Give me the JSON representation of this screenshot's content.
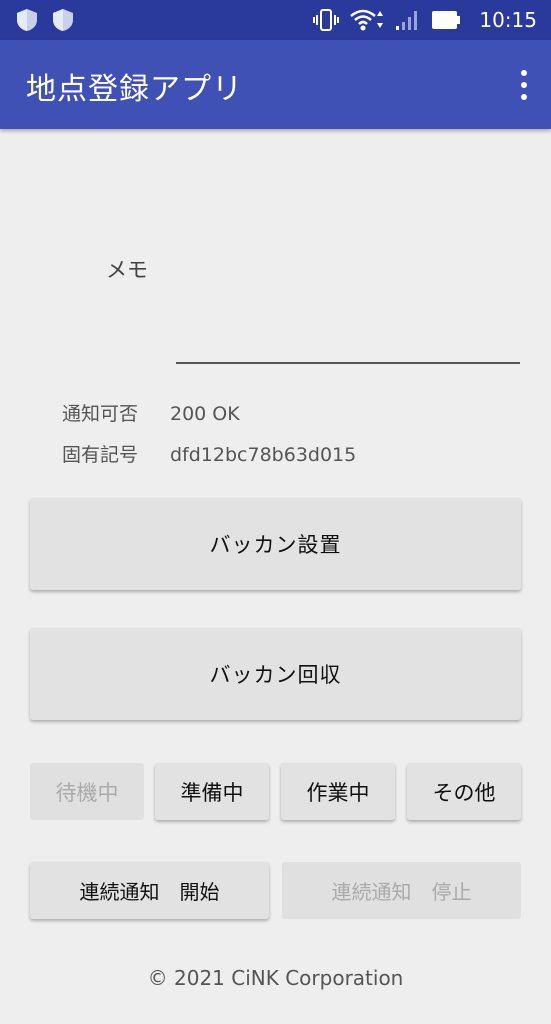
{
  "status_bar": {
    "time": "10:15",
    "icons": [
      "shield-icon",
      "shield-icon",
      "vibrate-icon",
      "wifi-icon",
      "signal-icon",
      "battery-icon"
    ]
  },
  "app_bar": {
    "title": "地点登録アプリ",
    "menu_icon": "more-vert-icon"
  },
  "form": {
    "memo_label": "メモ",
    "memo_value": "",
    "notify_label": "通知可否",
    "notify_value": "200 OK",
    "id_label": "固有記号",
    "id_value": "dfd12bc78b63d015"
  },
  "buttons": {
    "install": "バッカン設置",
    "collect": "バッカン回収",
    "status": [
      {
        "label": "待機中",
        "enabled": false
      },
      {
        "label": "準備中",
        "enabled": true
      },
      {
        "label": "作業中",
        "enabled": true
      },
      {
        "label": "その他",
        "enabled": true
      }
    ],
    "continuous_start": "連続通知　開始",
    "continuous_stop": "連続通知　停止"
  },
  "footer": "© 2021 CiNK Corporation",
  "colors": {
    "status_bar": "#2a3a9c",
    "app_bar": "#3f51b5",
    "background": "#eeeeee",
    "button": "#e2e2e2"
  }
}
